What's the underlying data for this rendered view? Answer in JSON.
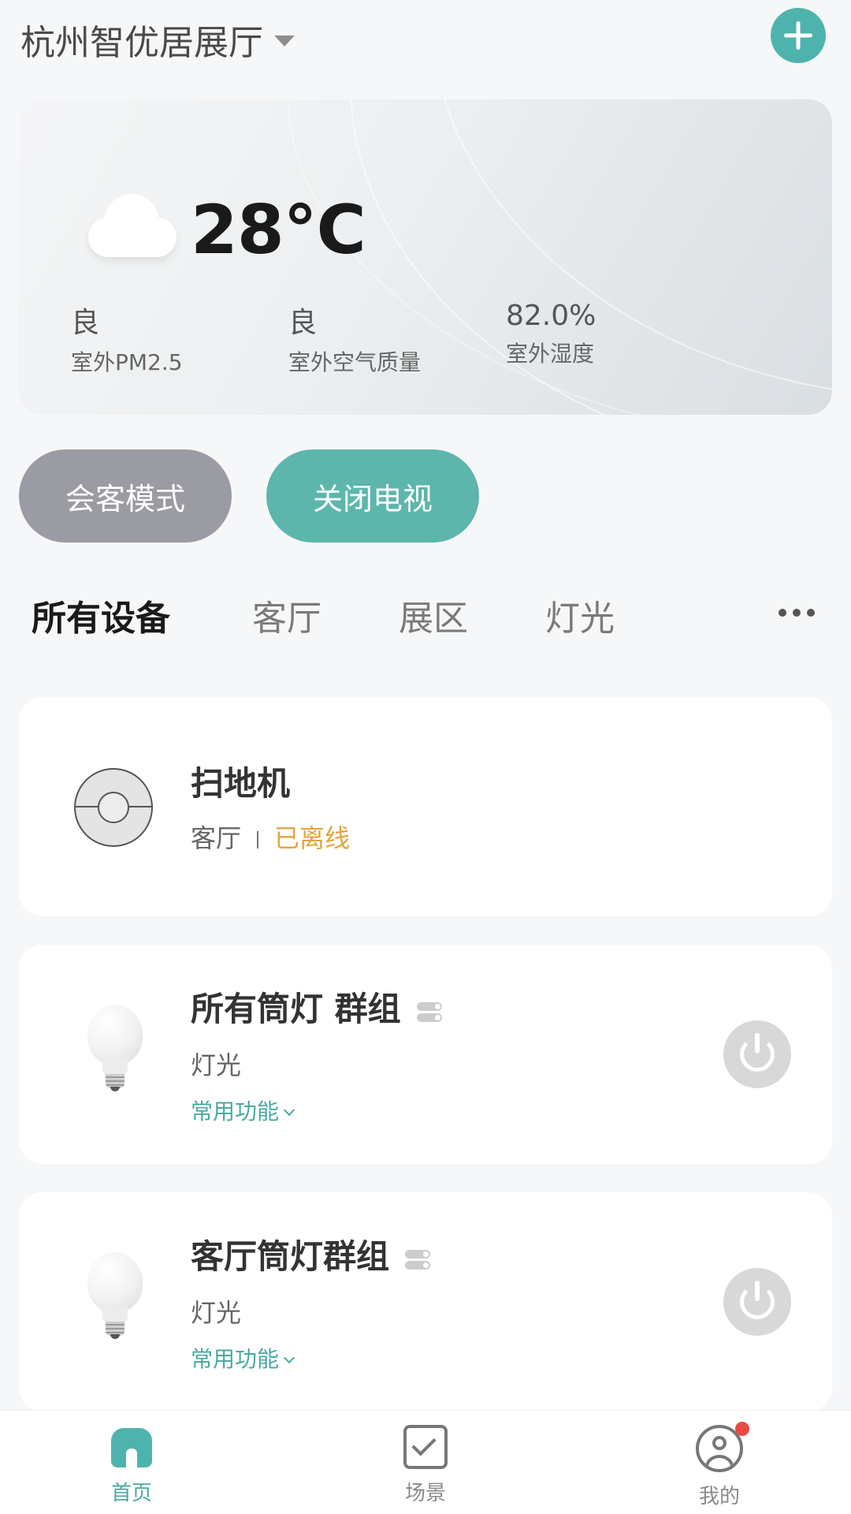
{
  "header": {
    "title": "杭州智优居展厅"
  },
  "weather": {
    "temperature": "28°C",
    "metrics": [
      {
        "value": "良",
        "label": "室外PM2.5"
      },
      {
        "value": "良",
        "label": "室外空气质量"
      },
      {
        "value": "82.0%",
        "label": "室外湿度"
      }
    ]
  },
  "scenes": [
    {
      "label": "会客模式",
      "color": "#9b9ba3"
    },
    {
      "label": "关闭电视",
      "color": "#5cb6ab"
    }
  ],
  "tabs": [
    "所有设备",
    "客厅",
    "展区",
    "灯光"
  ],
  "devices": [
    {
      "name": "扫地机",
      "room": "客厅",
      "status": "已离线",
      "icon": "robot-vacuum-icon"
    },
    {
      "name": "所有筒灯 群组",
      "room": "灯光",
      "function_label": "常用功能",
      "icon": "light-bulb-icon",
      "is_group": true
    },
    {
      "name": "客厅筒灯群组",
      "room": "灯光",
      "function_label": "常用功能",
      "icon": "light-bulb-icon",
      "is_group": true
    }
  ],
  "bottom_nav": [
    {
      "label": "首页",
      "icon": "home-icon",
      "active": true
    },
    {
      "label": "场景",
      "icon": "scene-check-icon",
      "active": false
    },
    {
      "label": "我的",
      "icon": "profile-icon",
      "active": false,
      "badge": true
    }
  ],
  "colors": {
    "accent": "#4fb3ad",
    "offline": "#e2a53c",
    "badge": "#ea4b42"
  }
}
